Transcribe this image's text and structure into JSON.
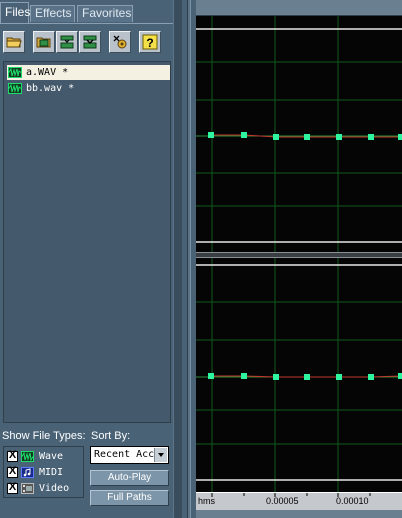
{
  "tabs": [
    {
      "label": "Files",
      "active": true
    },
    {
      "label": "Effects",
      "active": false
    },
    {
      "label": "Favorites",
      "active": false
    }
  ],
  "toolbar": {
    "buttons": [
      {
        "icon": "open-folder-icon"
      },
      {
        "icon": "open-file-icon"
      },
      {
        "icon": "close-file-icon"
      },
      {
        "icon": "close-all-icon"
      },
      {
        "icon": "auto-settings-icon"
      },
      {
        "icon": "help-icon",
        "glyph": "?"
      }
    ]
  },
  "files": [
    {
      "name": "a.WAV *",
      "selected": true
    },
    {
      "name": "bb.wav *",
      "selected": false
    }
  ],
  "show_file_types": {
    "label": "Show File Types:",
    "items": [
      {
        "label": "Wave",
        "checked": true,
        "mark": "X",
        "icon": "wave-icon"
      },
      {
        "label": "MIDI",
        "checked": true,
        "mark": "X",
        "icon": "midi-icon"
      },
      {
        "label": "Video",
        "checked": true,
        "mark": "X",
        "icon": "video-icon"
      }
    ]
  },
  "sort_by": {
    "label": "Sort By:",
    "value": "Recent Acc"
  },
  "buttons": {
    "auto_play": "Auto-Play",
    "full_paths": "Full Paths"
  },
  "ruler": {
    "unit": "hms",
    "ticks": [
      "0.00005",
      "0.00010"
    ]
  },
  "colors": {
    "panel_bg": "#4a6276",
    "waveform_bg": "#050505",
    "grid": "#0e5a1a",
    "sample_point": "#2ef5a0",
    "waveform_line": "#c0392b",
    "selected_row": "#f4f0e2",
    "marker": "#e8c61c"
  }
}
